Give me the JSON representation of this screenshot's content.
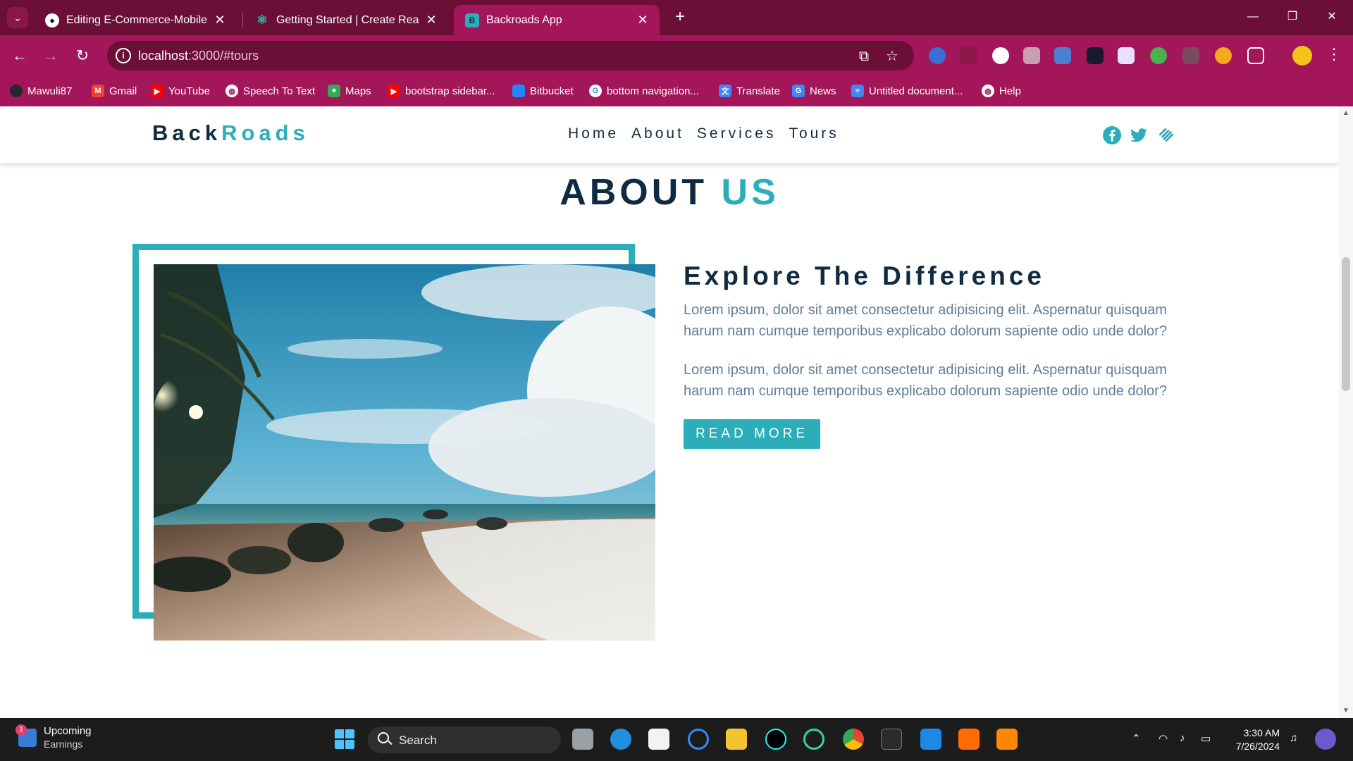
{
  "browser": {
    "tabs": [
      {
        "title": "Editing E-Commerce-Mobile-Ap",
        "active": false
      },
      {
        "title": "Getting Started | Create React A",
        "active": false
      },
      {
        "title": "Backroads App",
        "active": true
      }
    ],
    "url_host": "localhost",
    "url_path": ":3000/#tours",
    "bookmarks": [
      {
        "label": "Mawuli87",
        "icon": "github-icon",
        "color": "#24292e"
      },
      {
        "label": "Gmail",
        "icon": "gmail-icon",
        "color": "#ea4335"
      },
      {
        "label": "YouTube",
        "icon": "youtube-icon",
        "color": "#ff0000"
      },
      {
        "label": "Speech To Text",
        "icon": "globe-icon",
        "color": "#ffffff"
      },
      {
        "label": "Maps",
        "icon": "maps-icon",
        "color": "#34a853"
      },
      {
        "label": "bootstrap sidebar...",
        "icon": "youtube-icon",
        "color": "#ff0000"
      },
      {
        "label": "Bitbucket",
        "icon": "bitbucket-icon",
        "color": "#2684ff"
      },
      {
        "label": "bottom navigation...",
        "icon": "google-icon",
        "color": "#ffffff"
      },
      {
        "label": "Translate",
        "icon": "translate-icon",
        "color": "#4285f4"
      },
      {
        "label": "News",
        "icon": "news-icon",
        "color": "#4285f4"
      },
      {
        "label": "Untitled document...",
        "icon": "docs-icon",
        "color": "#4285f4"
      },
      {
        "label": "Help",
        "icon": "globe-icon",
        "color": "#ffffff"
      }
    ]
  },
  "site": {
    "logo_main": "Back",
    "logo_accent": "Roads",
    "nav": [
      "Home",
      "About",
      "Services",
      "Tours"
    ],
    "section_title_main": "ABOUT",
    "section_title_accent": "US",
    "heading": "Explore The Difference",
    "paragraph1": "Lorem ipsum, dolor sit amet consectetur adipisicing elit. Aspernatur quisquam harum nam cumque temporibus explicabo dolorum sapiente odio unde dolor?",
    "paragraph2": "Lorem ipsum, dolor sit amet consectetur adipisicing elit. Aspernatur quisquam harum nam cumque temporibus explicabo dolorum sapiente odio unde dolor?",
    "button": "READ MORE",
    "colors": {
      "primary": "#2caeba",
      "dark": "#102a42",
      "text": "#617d98"
    }
  },
  "taskbar": {
    "widget_title": "Upcoming",
    "widget_sub": "Earnings",
    "widget_badge": "1",
    "search_placeholder": "Search",
    "time": "3:30 AM",
    "date": "7/26/2024"
  }
}
